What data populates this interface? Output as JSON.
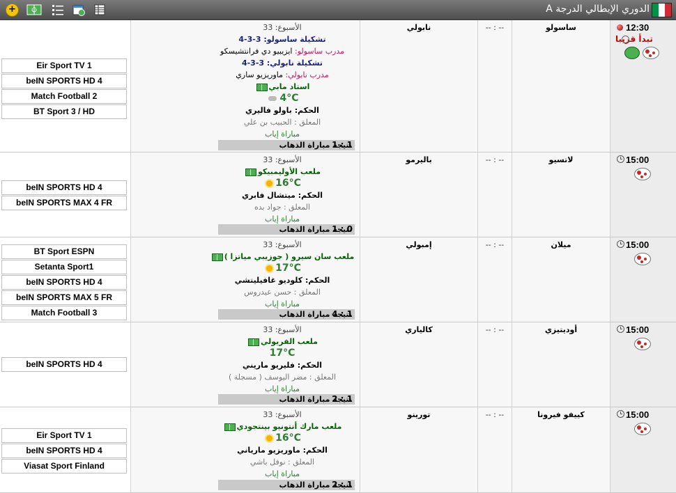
{
  "header": {
    "title": "الدوري الإيطالي الدرجة A",
    "plus_label": "+",
    "flag_colors": [
      "#009246",
      "#ffffff",
      "#ce2b37"
    ]
  },
  "matches": [
    {
      "time": "12:30",
      "status_text": "تبدأ قريبا",
      "home": "ساسولو",
      "away": "نابولي",
      "score": "-- : --",
      "week": "الأسبوع: 33",
      "home_formation": "تشكيلة ساسولو: 3-3-4",
      "home_coach_label": "مدرب ساسولو:",
      "home_coach": "ايزيبيو دي فرانتشيسكو",
      "away_formation": "تشكيلة نابولي: 3-3-4",
      "away_coach_label": "مدرب نابولي:",
      "away_coach": "ماوريزيو ساري",
      "venue": "استاد مابي",
      "temperature": "4°C",
      "referee": "الحكم: باولو فاليري",
      "commentator": "المعلق : الحبيب بن علي",
      "leg": "مباراة إياب",
      "aggregate_label": "نتيجة مباراة الذهاب",
      "aggregate_score": "1 : 1",
      "channels": [
        "Eir Sport TV 1",
        "beIN SPORTS HD 4",
        "Match Football 2",
        "BT Sport 3 / HD"
      ]
    },
    {
      "time": "15:00",
      "home": "لاتسيو",
      "away": "باليرمو",
      "score": "-- : --",
      "week": "الأسبوع: 33",
      "venue": "ملعب الأوليمبيكو",
      "temperature": "16°C",
      "referee": "الحكم: ميتشال فابري",
      "commentator": "المعلق : جواد بده",
      "leg": "مباراة إياب",
      "aggregate_label": "نتيجة مباراة الذهاب",
      "aggregate_score": "1 : 0",
      "channels": [
        "beIN SPORTS HD 4",
        "beIN SPORTS MAX 4 FR"
      ]
    },
    {
      "time": "15:00",
      "home": "ميلان",
      "away": "إمبولي",
      "score": "-- : --",
      "week": "الأسبوع: 33",
      "venue": "ملعب سان سيرو ( جوزيبي مياتزا )",
      "temperature": "17°C",
      "referee": "الحكم: كلوديو غافيليتشي",
      "commentator": "المعلق : حسن عيدروس",
      "leg": "مباراة إياب",
      "aggregate_label": "نتيجة مباراة الذهاب",
      "aggregate_score": "4 : 1",
      "channels": [
        "BT Sport ESPN",
        "Setanta Sport1",
        "beIN SPORTS HD 4",
        "beIN SPORTS MAX 5 FR",
        "Match Football 3"
      ]
    },
    {
      "time": "15:00",
      "home": "أوديتيزي",
      "away": "كالياري",
      "score": "-- : --",
      "week": "الأسبوع: 33",
      "venue": "ملعب الفريولي",
      "temperature": "17°C",
      "referee": "الحكم: فليريو ماريني",
      "commentator": "المعلق : مضر اليوسف ( مسجلة )",
      "leg": "مباراة إياب",
      "aggregate_label": "نتيجة مباراة الذهاب",
      "aggregate_score": "2 : 1",
      "channels": [
        "beIN SPORTS HD 4"
      ]
    },
    {
      "time": "15:00",
      "home": "كييفو فيرونا",
      "away": "تورينو",
      "score": "-- : --",
      "week": "الأسبوع: 33",
      "venue": "ملعب مارك أنتونيو بينتجودي",
      "temperature": "16°C",
      "referee": "الحكم: ماوريزيو مارياني",
      "commentator": "المعلق : نوفل باشي",
      "leg": "مباراة إياب",
      "aggregate_label": "نتيجة مباراة الذهاب",
      "aggregate_score": "2 : 1",
      "channels": [
        "Eir Sport TV 1",
        "beIN SPORTS HD 4",
        "Viasat Sport Finland"
      ]
    }
  ]
}
